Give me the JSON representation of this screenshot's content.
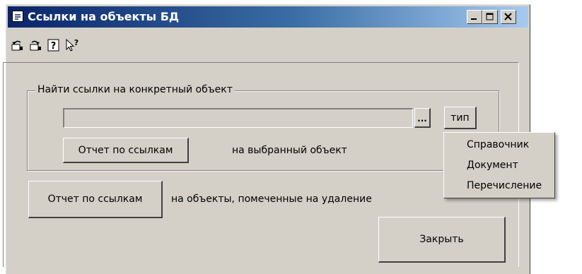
{
  "window": {
    "title": "Ссылки на объекты БД",
    "controls": {
      "minimize": "_",
      "maximize": "□",
      "close": "✕"
    }
  },
  "toolbar": {
    "icons": [
      "undo-icon",
      "redo-icon",
      "help-icon",
      "context-help-icon"
    ]
  },
  "group": {
    "legend": "Найти ссылки на конкретный объект",
    "object_field_value": "",
    "browse_button": "...",
    "type_button": "тип",
    "report_button": "Отчет по ссылкам",
    "report_note": "на выбранный объект"
  },
  "main": {
    "report_button": "Отчет по ссылкам",
    "report_note": "на объекты, помеченные на удаление",
    "close_button": "Закрыть"
  },
  "type_menu": {
    "items": [
      "Справочник",
      "Документ",
      "Перечисление"
    ]
  }
}
